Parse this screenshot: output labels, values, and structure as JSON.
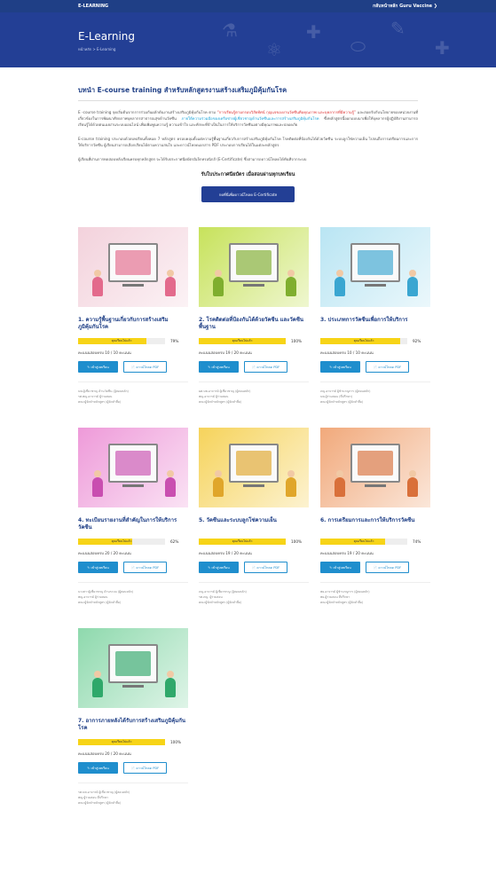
{
  "topbar": {
    "brand": "E-LEARNING",
    "back_link": "กลับหน้าหลัก Guru Vaccine ❯"
  },
  "hero": {
    "title": "E-Learning",
    "breadcrumb": "หน้าหลัก > E-Learning"
  },
  "intro": {
    "heading": "บทนำ E-course training สำหรับหลักสูตรงานสร้างเสริมภูมิคุ้มกันโรค",
    "p1_a": "E -course training จุดเริ่มต้นจากการร่วมกันผลักดันงานสร้างเสริมภูมิคุ้มกันโรค ตาม",
    "p1_red": "“การเรียนรู้ตามกรอบวิสัยทัศน์ กุญแจของงานวัคซีนคือคุณภาพ และบุคลากรที่มีความรู้”",
    "p1_b": "และสอดรับกับนโยบายของหน่วยงานที่เกี่ยวข้องในการพัฒนาศักยภาพบุคลากรสาธารณสุขด้านวัคซีน",
    "p1_link": "ภายใต้ความร่วมมือของเครือข่ายผู้เชี่ยวชาญด้านวัคซีนและการสร้างเสริมภูมิคุ้มกันโรค",
    "p1_c": "ซึ่งหลักสูตรนี้ออกแบบมาเพื่อให้บุคลากรผู้ปฏิบัติงานสามารถเรียนรู้ได้ด้วยตนเองผ่านระบบออนไลน์ เพื่อเพิ่มพูนความรู้ ความเข้าใจ และทักษะที่จำเป็นในการให้บริการวัคซีนอย่างมีคุณภาพและปลอดภัย",
    "p2": "E-course training ประกอบด้วยบทเรียนทั้งหมด 7 หลักสูตร ครอบคลุมตั้งแต่ความรู้พื้นฐานเกี่ยวกับการสร้างเสริมภูมิคุ้มกันโรค โรคติดต่อที่ป้องกันได้ด้วยวัคซีน ระบบลูกโซ่ความเย็น ไปจนถึงการเตรียมการและการให้บริการวัคซีน ผู้เรียนสามารถเลือกเรียนได้ตามความสนใจ และดาวน์โหลดเอกสาร PDF ประกอบการเรียนได้ในแต่ละหลักสูตร",
    "p3": "ผู้เรียนที่ผ่านการทดสอบหลังเรียนครบทุกหลักสูตร จะได้รับประกาศนียบัตรอิเล็กทรอนิกส์ (E-Certificate) ซึ่งสามารถดาวน์โหลดได้ทันทีจากระบบ"
  },
  "certificate": {
    "title": "รับใบประกาศนียบัตร เมื่อสอบผ่านทุกบทเรียน",
    "button": "กดที่นี่เพื่อดาวน์โหลด E-Certificate"
  },
  "courses": [
    {
      "title": "1. ความรู้พื้นฐานเกี่ยวกับการสร้างเสริมภูมิคุ้มกันโรค",
      "progress_label": "คุณเรียนไปแล้ว",
      "percent": "79%",
      "progress": 0.79,
      "score": "คะแนนสอบครบ 10 / 10 คะแนน",
      "learn": "เข้าสู่บทเรียน",
      "pdf": "ดาวน์โหลด PDF",
      "authors": [
        "นพ.ผู้เชี่ยวชาญ ด้านวัคซีน (ผู้สอนหลัก)",
        "รศ.พญ.อาจารย์ ผู้ร่วมสอน",
        "คณะผู้จัดทำหลักสูตร (ผู้จัดทำสื่อ)"
      ],
      "color": "#f3d2dc",
      "accent": "#e36a8c"
    },
    {
      "title": "2. โรคติดต่อที่ป้องกันได้ด้วยวัคซีน และวัคซีนพื้นฐาน",
      "progress_label": "คุณเรียนไปแล้ว",
      "percent": "100%",
      "progress": 1.0,
      "score": "คะแนนสอบครบ 19 / 20 คะแนน",
      "learn": "เข้าสู่บทเรียน",
      "pdf": "ดาวน์โหลด PDF",
      "authors": [
        "ผศ.นพ.อาจารย์ ผู้เชี่ยวชาญ (ผู้สอนหลัก)",
        "พญ.อาจารย์ ผู้ร่วมสอน",
        "คณะผู้จัดทำหลักสูตร (ผู้จัดทำสื่อ)"
      ],
      "color": "#c7e25b",
      "accent": "#7fae2e"
    },
    {
      "title": "3. ประเภทการวัคซีนเพื่อการให้บริการ",
      "progress_label": "คุณเรียนไปแล้ว",
      "percent": "92%",
      "progress": 0.92,
      "score": "คะแนนสอบครบ 10 / 10 คะแนน",
      "learn": "เข้าสู่บทเรียน",
      "pdf": "ดาวน์โหลด PDF",
      "authors": [
        "ภญ.อาจารย์ ผู้ชำนาญการ (ผู้สอนหลัก)",
        "นพ.ผู้ร่วมสอน (ที่ปรึกษา)",
        "คณะผู้จัดทำหลักสูตร (ผู้จัดทำสื่อ)"
      ],
      "color": "#b9e5f3",
      "accent": "#3aa6d1"
    },
    {
      "title": "4. ทะเบียนรายงานที่สำคัญในการให้บริการวัคซีน",
      "progress_label": "คุณเรียนไปแล้ว",
      "percent": "62%",
      "progress": 0.62,
      "score": "คะแนนสอบครบ 20 / 20 คะแนน",
      "learn": "เข้าสู่บทเรียน",
      "pdf": "ดาวน์โหลด PDF",
      "authors": [
        "นางสาวผู้เชี่ยวชาญ ด้านระบบ (ผู้สอนหลัก)",
        "พญ.อาจารย์ ผู้ร่วมสอน",
        "คณะผู้จัดทำหลักสูตร (ผู้จัดทำสื่อ)"
      ],
      "color": "#ee9ad9",
      "accent": "#c94eb0"
    },
    {
      "title": "5. วัคซีนและระบบลูกโซ่ความเย็น",
      "progress_label": "คุณเรียนไปแล้ว",
      "percent": "100%",
      "progress": 1.0,
      "score": "คะแนนสอบครบ 19 / 20 คะแนน",
      "learn": "เข้าสู่บทเรียน",
      "pdf": "ดาวน์โหลด PDF",
      "authors": [
        "ภญ.อาจารย์ ผู้เชี่ยวชาญ (ผู้สอนหลัก)",
        "รศ.ภญ. ผู้ร่วมสอน",
        "คณะผู้จัดทำหลักสูตร (ผู้จัดทำสื่อ)"
      ],
      "color": "#f6d35b",
      "accent": "#e0a62a"
    },
    {
      "title": "6. การเตรียมการและการให้บริการวัคซีน",
      "progress_label": "คุณเรียนไปแล้ว",
      "percent": "74%",
      "progress": 0.74,
      "score": "คะแนนสอบครบ 19 / 20 คะแนน",
      "learn": "เข้าสู่บทเรียน",
      "pdf": "ดาวน์โหลด PDF",
      "authors": [
        "พย.อาจารย์ ผู้ชำนาญการ (ผู้สอนหลัก)",
        "พย.ผู้ร่วมสอน ที่ปรึกษา",
        "คณะผู้จัดทำหลักสูตร (ผู้จัดทำสื่อ)"
      ],
      "color": "#f1a97b",
      "accent": "#d9703a"
    },
    {
      "title": "7. อาการภายหลังได้รับการสร้างเสริมภูมิคุ้มกันโรค",
      "progress_label": "คุณเรียนไปแล้ว",
      "percent": "100%",
      "progress": 1.0,
      "score": "คะแนนสอบครบ 20 / 20 คะแนน",
      "learn": "เข้าสู่บทเรียน",
      "pdf": "ดาวน์โหลด PDF",
      "authors": [
        "รศ.นพ.อาจารย์ ผู้เชี่ยวชาญ (ผู้สอนหลัก)",
        "พญ.ผู้ร่วมสอน ที่ปรึกษา",
        "คณะผู้จัดทำหลักสูตร (ผู้จัดทำสื่อ)"
      ],
      "color": "#8ed9ad",
      "accent": "#2fa86a"
    }
  ]
}
